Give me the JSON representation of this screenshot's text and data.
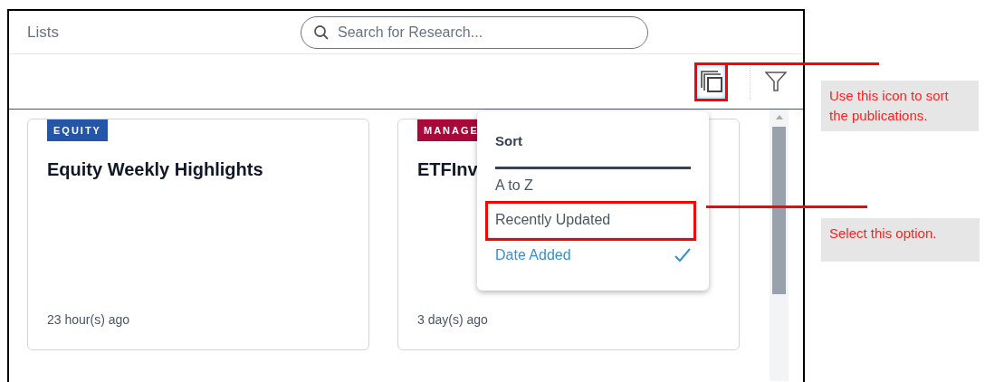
{
  "header": {
    "title": "Lists",
    "search": {
      "placeholder": "Search for Research..."
    }
  },
  "toolbar": {
    "sort_button": {
      "highlighted": true
    }
  },
  "cards": [
    {
      "tag": "EQUITY",
      "color": "#2356a8",
      "title": "Equity Weekly Highlights",
      "time": "23 hour(s) ago"
    },
    {
      "tag": "MANAGE",
      "color": "#a8083a",
      "title": "ETFInv",
      "time": "3 day(s) ago"
    }
  ],
  "sort_menu": {
    "title": "Sort",
    "options": [
      {
        "label": "A to Z",
        "selected": false,
        "highlighted": false
      },
      {
        "label": "Recently Updated",
        "selected": false,
        "highlighted": true
      },
      {
        "label": "Date Added",
        "selected": true,
        "highlighted": false
      }
    ]
  },
  "callouts": [
    {
      "text": "Use this icon to sort the publications."
    },
    {
      "text": "Select this option."
    }
  ]
}
